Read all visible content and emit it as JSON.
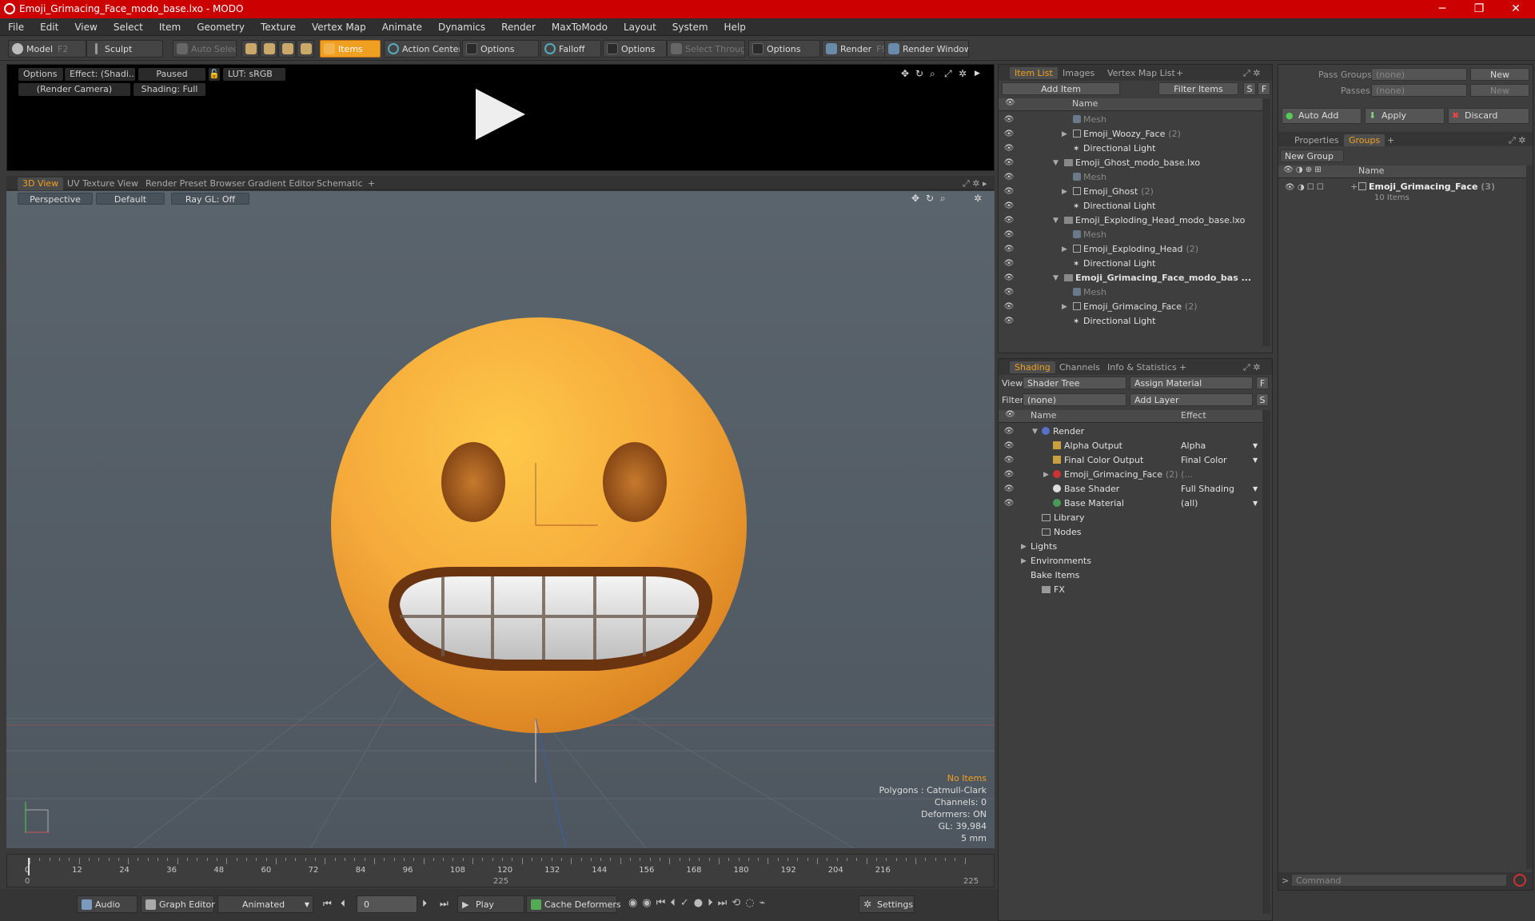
{
  "window": {
    "title": "Emoji_Grimacing_Face_modo_base.lxo - MODO",
    "min": "─",
    "max": "❐",
    "close": "✕"
  },
  "menu": [
    "File",
    "Edit",
    "View",
    "Select",
    "Item",
    "Geometry",
    "Texture",
    "Vertex Map",
    "Animate",
    "Dynamics",
    "Render",
    "MaxToModo",
    "Layout",
    "System",
    "Help"
  ],
  "toolbar": {
    "model": "Model",
    "model_key": "F2",
    "sculpt": "Sculpt",
    "auto_select": "Auto Select",
    "items": "Items",
    "action_center": "Action Center",
    "options1": "Options",
    "falloff": "Falloff",
    "options2": "Options",
    "select_through": "Select Through",
    "options3": "Options",
    "render": "Render",
    "render_key": "F9",
    "render_window": "Render Window"
  },
  "preview": {
    "options": "Options",
    "effect": "Effect: (Shadi...",
    "paused": "Paused",
    "lut": "LUT: sRGB",
    "camera": "(Render Camera)",
    "shading": "Shading: Full"
  },
  "viewport_tabs": [
    "3D View",
    "UV Texture View",
    "Render Preset Browser",
    "Gradient Editor",
    "Schematic"
  ],
  "viewport": {
    "perspective": "Perspective",
    "default": "Default",
    "raygl": "Ray GL: Off",
    "info": {
      "no_items": "No Items",
      "polygons": "Polygons : Catmull-Clark",
      "channels": "Channels: 0",
      "deformers": "Deformers: ON",
      "gl": "GL: 39,984",
      "unit": "5 mm"
    }
  },
  "timeline": {
    "ticks": [
      "0",
      "12",
      "24",
      "36",
      "48",
      "60",
      "72",
      "84",
      "96",
      "108",
      "120",
      "132",
      "144",
      "156",
      "168",
      "180",
      "192",
      "204",
      "216"
    ],
    "start": "0",
    "mid": "225",
    "end": "225"
  },
  "bottombar": {
    "audio": "Audio",
    "graph_editor": "Graph Editor",
    "animated": "Animated",
    "frame": "0",
    "play": "Play",
    "cache": "Cache Deformers",
    "settings": "Settings"
  },
  "item_panel": {
    "tabs": [
      "Item List",
      "Images",
      "Vertex Map List"
    ],
    "add_item": "Add Item",
    "filter": "Filter Items",
    "s": "S",
    "f": "F",
    "col_name": "Name",
    "rows": [
      {
        "label": "Mesh",
        "kind": "mesh",
        "indent": 3
      },
      {
        "label": "Emoji_Woozy_Face",
        "count": "(2)",
        "kind": "item",
        "indent": 3,
        "expander": "▶"
      },
      {
        "label": "Directional Light",
        "kind": "light",
        "indent": 3
      },
      {
        "label": "Emoji_Ghost_modo_base.lxo",
        "kind": "scene",
        "indent": 2,
        "expander": "▼"
      },
      {
        "label": "Mesh",
        "kind": "mesh",
        "indent": 3
      },
      {
        "label": "Emoji_Ghost",
        "count": "(2)",
        "kind": "item",
        "indent": 3,
        "expander": "▶"
      },
      {
        "label": "Directional Light",
        "kind": "light",
        "indent": 3
      },
      {
        "label": "Emoji_Exploding_Head_modo_base.lxo",
        "kind": "scene",
        "indent": 2,
        "expander": "▼"
      },
      {
        "label": "Mesh",
        "kind": "mesh",
        "indent": 3
      },
      {
        "label": "Emoji_Exploding_Head",
        "count": "(2)",
        "kind": "item",
        "indent": 3,
        "expander": "▶"
      },
      {
        "label": "Directional Light",
        "kind": "light",
        "indent": 3
      },
      {
        "label": "Emoji_Grimacing_Face_modo_bas ...",
        "kind": "scene",
        "indent": 2,
        "expander": "▼",
        "bold": true
      },
      {
        "label": "Mesh",
        "kind": "mesh",
        "indent": 3
      },
      {
        "label": "Emoji_Grimacing_Face",
        "count": "(2)",
        "kind": "item",
        "indent": 3,
        "expander": "▶"
      },
      {
        "label": "Directional Light",
        "kind": "light",
        "indent": 3
      }
    ]
  },
  "shading_panel": {
    "tabs": [
      "Shading",
      "Channels",
      "Info & Statistics"
    ],
    "view_label": "View",
    "view_value": "Shader Tree",
    "assign": "Assign Material",
    "f": "F",
    "filter_label": "Filter",
    "filter_value": "(none)",
    "add_layer": "Add Layer",
    "s": "S",
    "col_name": "Name",
    "col_effect": "Effect",
    "rows": [
      {
        "label": "Render",
        "effect": "",
        "indent": 1,
        "expander": "▼",
        "icon": "render"
      },
      {
        "label": "Alpha Output",
        "effect": "Alpha",
        "indent": 2,
        "icon": "output"
      },
      {
        "label": "Final Color Output",
        "effect": "Final Color",
        "indent": 2,
        "icon": "output"
      },
      {
        "label": "Emoji_Grimacing_Face",
        "count": "(2) (...",
        "effect": "",
        "indent": 2,
        "expander": "▶",
        "icon": "material"
      },
      {
        "label": "Base Shader",
        "effect": "Full Shading",
        "indent": 2,
        "icon": "shader"
      },
      {
        "label": "Base Material",
        "effect": "(all)",
        "indent": 2,
        "icon": "basemat"
      },
      {
        "label": "Library",
        "effect": "",
        "indent": 1,
        "icon": "folder"
      },
      {
        "label": "Nodes",
        "effect": "",
        "indent": 1,
        "icon": "folder"
      },
      {
        "label": "Lights",
        "effect": "",
        "indent": 0,
        "expander": "▶",
        "icon": "none"
      },
      {
        "label": "Environments",
        "effect": "",
        "indent": 0,
        "expander": "▶",
        "icon": "none"
      },
      {
        "label": "Bake Items",
        "effect": "",
        "indent": 0,
        "icon": "none"
      },
      {
        "label": "FX",
        "effect": "",
        "indent": 1,
        "icon": "fx"
      }
    ]
  },
  "groups_panel": {
    "pass_groups": "Pass Groups",
    "pass_value": "(none)",
    "new1": "New",
    "passes": "Passes",
    "passes_value": "(none)",
    "new2": "New",
    "auto_add": "Auto Add",
    "apply": "Apply",
    "discard": "Discard",
    "tabs": [
      "Properties",
      "Groups"
    ],
    "new_group": "New Group",
    "col_name": "Name",
    "group_name": "Emoji_Grimacing_Face",
    "group_count": "(3)",
    "group_items": "10 Items"
  },
  "command": "Command",
  "colors": {
    "accent": "#f0a020",
    "title": "#cc0000",
    "face": "#f5a93a"
  }
}
